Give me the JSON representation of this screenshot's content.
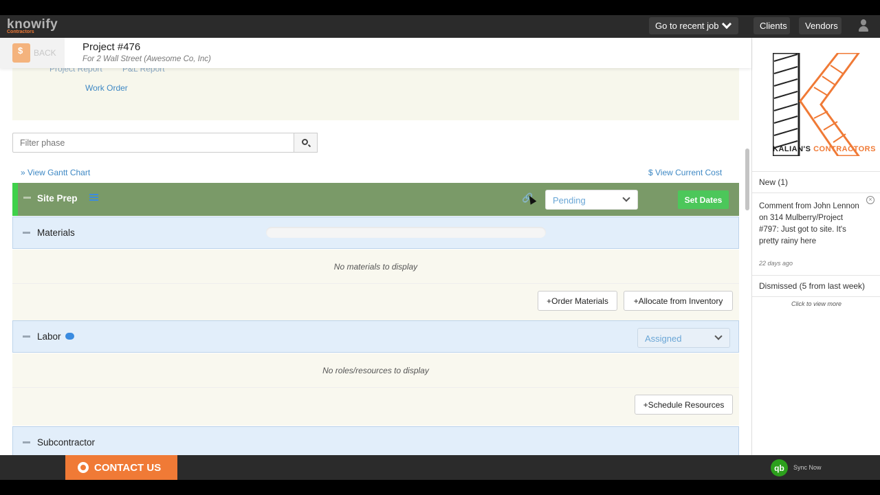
{
  "topnav": {
    "logo": "knowify",
    "logo_sub": "Contractors",
    "recent_job": "Go to recent job",
    "clients": "Clients",
    "vendors": "Vendors"
  },
  "header": {
    "back": "BACK",
    "title": "Project #476",
    "subtitle": "For 2 Wall Street (Awesome Co, Inc)"
  },
  "reports": {
    "project_report": "Project Report",
    "pl_report": "P&L Report",
    "work_order": "Work Order"
  },
  "filter": {
    "placeholder": "Filter phase"
  },
  "links": {
    "gantt": "» View Gantt Chart",
    "cost": "$ View Current Cost"
  },
  "phase": {
    "title": "Site Prep",
    "status": "Pending",
    "set_dates": "Set Dates"
  },
  "materials": {
    "title": "Materials",
    "empty": "No materials to display",
    "order": "+Order Materials",
    "allocate": "+Allocate from Inventory"
  },
  "labor": {
    "title": "Labor",
    "status": "Assigned",
    "empty": "No roles/resources to display",
    "schedule": "+Schedule Resources"
  },
  "subcontractor": {
    "title": "Subcontractor"
  },
  "sidebar": {
    "brand_a": "KALIAN'S",
    "brand_b": "CONTRACTORS",
    "new": "New (1)",
    "comment": "Comment from John Lennon on 314 Mulberry/Project #797: Just got to site. It's pretty rainy here",
    "ago": "22 days ago",
    "dismissed": "Dismissed (5 from last week)",
    "more": "Click to view more"
  },
  "footer": {
    "contact": "CONTACT US",
    "sync": "Sync Now"
  },
  "colors": {
    "accent": "#f07a36",
    "phase_green": "#7a9a68",
    "link_blue": "#3e88c4",
    "section_blue": "#e2eefa"
  }
}
